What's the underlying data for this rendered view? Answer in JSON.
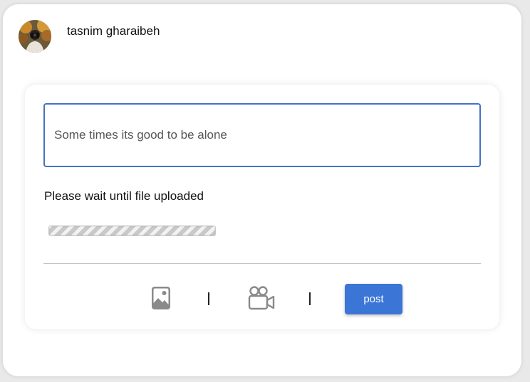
{
  "user": {
    "name": "tasnim gharaibeh",
    "avatar_icon": "user-photo-avatar"
  },
  "composer": {
    "input_value": "Some times its good to be alone",
    "status_text": "Please wait until file uploaded",
    "upload_progress": 1.0
  },
  "toolbar": {
    "image_icon": "image-icon",
    "separator_1": "|",
    "video_icon": "video-camera-icon",
    "separator_2": "|",
    "post_label": "post"
  },
  "colors": {
    "input_border": "#4472c4",
    "post_button": "#3b76d6",
    "icon_gray": "#8a8a8a"
  }
}
